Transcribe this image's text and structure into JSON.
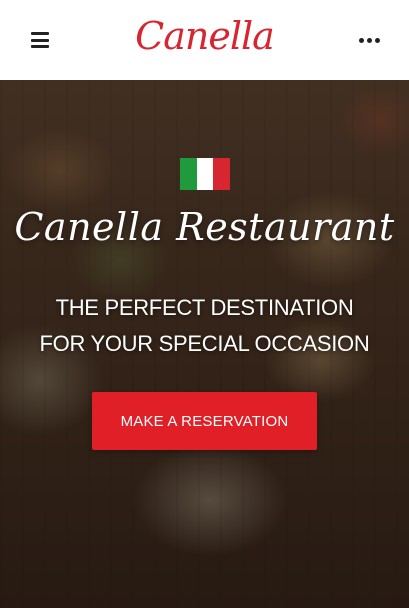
{
  "header": {
    "logo_text": "Canella"
  },
  "hero": {
    "title": "Canella Restaurant",
    "subtitle": "THE PERFECT DESTINATION FOR YOUR SPECIAL OCCASION",
    "cta_label": "MAKE A RESERVATION",
    "flag": "italian-flag"
  },
  "colors": {
    "brand_red": "#d7262f",
    "cta_red": "#e01f27",
    "header_bg": "#ffffff"
  },
  "icons": {
    "menu": "hamburger-menu-icon",
    "more": "more-options-icon"
  }
}
